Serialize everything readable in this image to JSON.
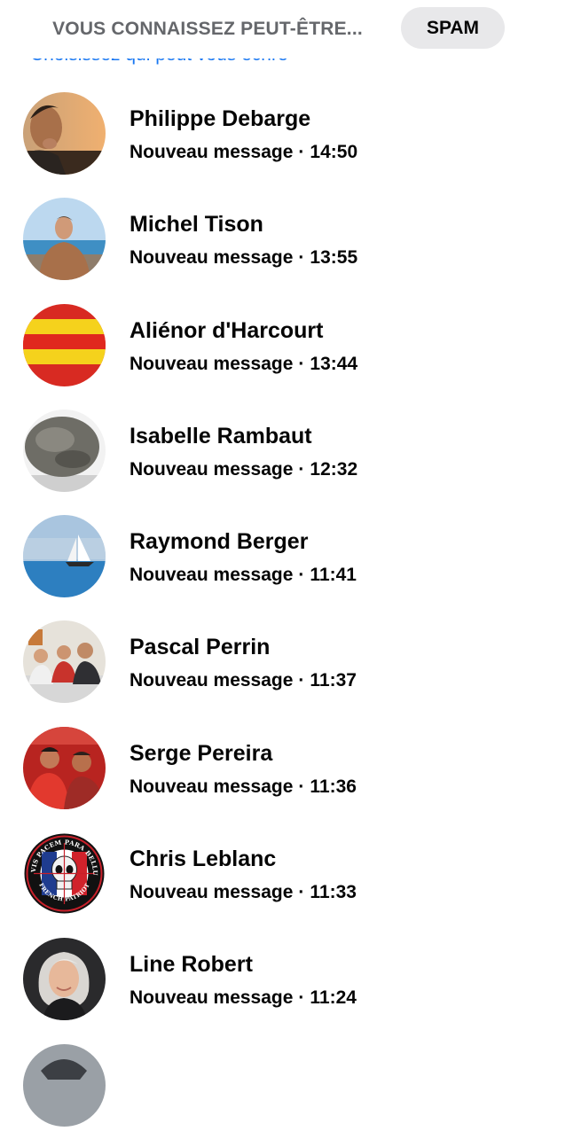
{
  "tabs": {
    "known_label": "VOUS CONNAISSEZ PEUT-ÊTRE...",
    "spam_label": "SPAM"
  },
  "hint_text": "Choisissez qui peut vous écrire",
  "conversations": [
    {
      "name": "Philippe Debarge",
      "status": "Nouveau message",
      "time": "14:50",
      "avatar": "photo-man-sunset"
    },
    {
      "name": "Michel Tison",
      "status": "Nouveau message",
      "time": "13:55",
      "avatar": "photo-man-sea"
    },
    {
      "name": "Aliénor d'Harcourt",
      "status": "Nouveau message",
      "time": "13:44",
      "avatar": "flag-red-yellow-stripes"
    },
    {
      "name": "Isabelle Rambaut",
      "status": "Nouveau message",
      "time": "12:32",
      "avatar": "photo-boulder"
    },
    {
      "name": "Raymond Berger",
      "status": "Nouveau message",
      "time": "11:41",
      "avatar": "photo-sailboat"
    },
    {
      "name": "Pascal Perrin",
      "status": "Nouveau message",
      "time": "11:37",
      "avatar": "photo-group-table"
    },
    {
      "name": "Serge Pereira",
      "status": "Nouveau message",
      "time": "11:36",
      "avatar": "photo-two-men-red"
    },
    {
      "name": "Chris Leblanc",
      "status": "Nouveau message",
      "time": "11:33",
      "avatar": "badge-french-patriot"
    },
    {
      "name": "Line Robert",
      "status": "Nouveau message",
      "time": "11:24",
      "avatar": "photo-woman-gray-hair"
    }
  ],
  "badge_text": {
    "top": "SI VIS PACEM PARA BELLUM",
    "bottom": "FRENCH PATRIOT"
  },
  "colors": {
    "link_blue": "#1877f2",
    "secondary_text": "#65676b",
    "chip_bg": "#e8e8ea"
  }
}
